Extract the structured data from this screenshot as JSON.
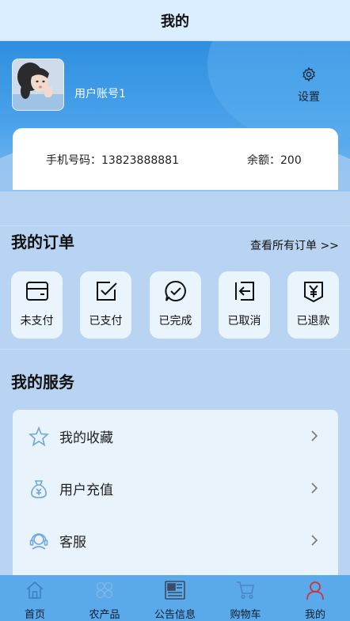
{
  "header": {
    "title": "我的"
  },
  "profile": {
    "username": "用户账号1",
    "settings_label": "设置",
    "phone_label": "手机号码：",
    "phone_value": "13823888881",
    "balance_label": "余额：",
    "balance_value": "200"
  },
  "orders": {
    "title": "我的订单",
    "view_all": "查看所有订单 >>",
    "items": [
      {
        "label": "未支付",
        "icon": "card-icon"
      },
      {
        "label": "已支付",
        "icon": "checkbox-icon"
      },
      {
        "label": "已完成",
        "icon": "chat-check-icon"
      },
      {
        "label": "已取消",
        "icon": "exit-arrow-icon"
      },
      {
        "label": "已退款",
        "icon": "yen-envelope-icon"
      }
    ]
  },
  "services": {
    "title": "我的服务",
    "items": [
      {
        "label": "我的收藏",
        "icon": "star-icon"
      },
      {
        "label": "用户充值",
        "icon": "money-bag-icon"
      },
      {
        "label": "客服",
        "icon": "headset-icon"
      }
    ]
  },
  "tabbar": {
    "items": [
      {
        "label": "首页",
        "icon": "home-icon",
        "active": false
      },
      {
        "label": "农产品",
        "icon": "grid-icon",
        "active": false
      },
      {
        "label": "公告信息",
        "icon": "newspaper-icon",
        "active": false
      },
      {
        "label": "购物车",
        "icon": "cart-icon",
        "active": false
      },
      {
        "label": "我的",
        "icon": "user-icon",
        "active": true
      }
    ]
  },
  "colors": {
    "accent": "#2e8fe0",
    "tabbar": "#5aa9ea",
    "page_background": "#b9d4f3",
    "active_tab": "#c8353b"
  }
}
